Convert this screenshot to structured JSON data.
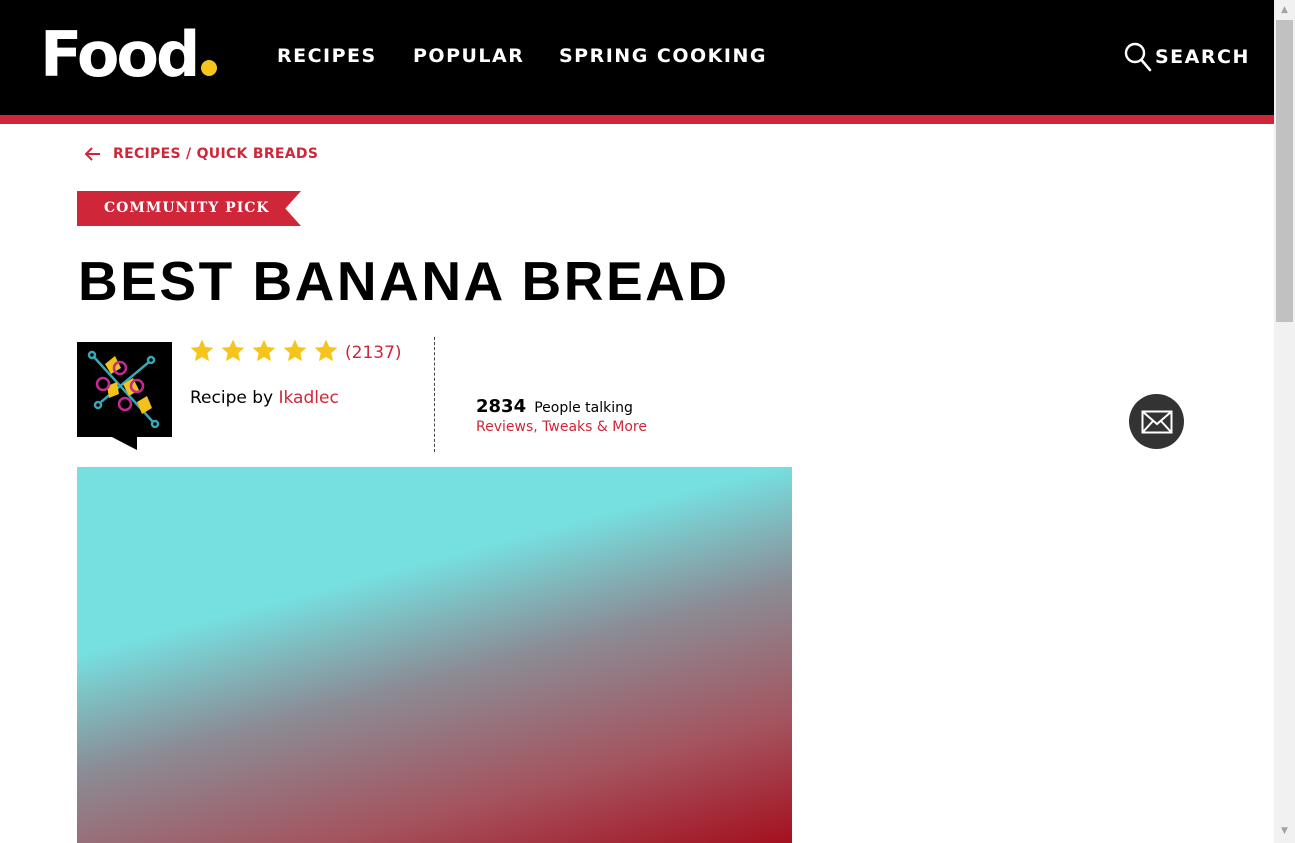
{
  "header": {
    "logo_text": "Food",
    "nav": [
      "RECIPES",
      "POPULAR",
      "SPRING COOKING"
    ],
    "search_label": "SEARCH"
  },
  "breadcrumb": {
    "path": "RECIPES / QUICK BREADS"
  },
  "badge": "COMMUNITY PICK",
  "recipe": {
    "title": "BEST BANANA BREAD",
    "rating": 5,
    "rating_max": 5,
    "rating_count": "(2137)",
    "byline_prefix": "Recipe by",
    "author": "Ikadlec"
  },
  "discussion": {
    "count": "2834",
    "label": "People talking",
    "link": "Reviews, Tweaks & More"
  },
  "colors": {
    "brand_red": "#d0263a",
    "logo_dot": "#f6c51b",
    "star": "#f6c51b",
    "header_bg": "#000000"
  },
  "icons": [
    "back-arrow-icon",
    "search-icon",
    "star-icon",
    "mail-icon",
    "user-avatar-icon"
  ]
}
